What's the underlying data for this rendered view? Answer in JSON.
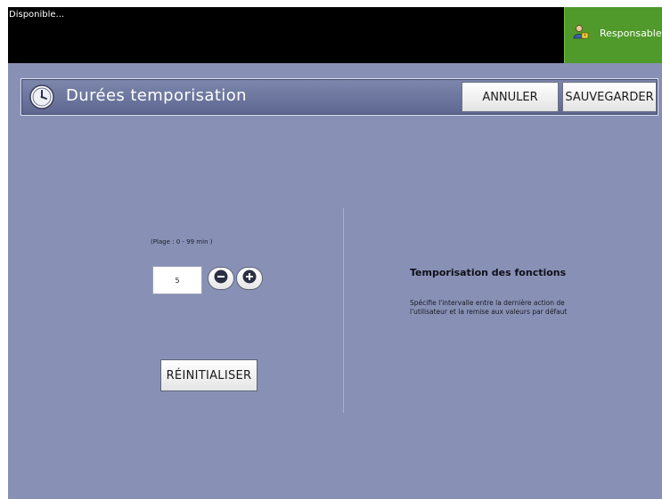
{
  "status_bar": {
    "status_text": "Disponible...",
    "user_label": "Responsable",
    "user_icon": "user-key-icon"
  },
  "header": {
    "title": "Durées temporisation",
    "title_icon": "clock-icon",
    "cancel_label": "ANNULER",
    "save_label": "SAUVEGARDER"
  },
  "control": {
    "range_label": "(Plage :  0 - 99 min )",
    "value": "5",
    "minus_icon": "minus-icon",
    "plus_icon": "plus-icon",
    "reset_label": "RÉINITIALISER"
  },
  "description": {
    "title": "Temporisation des fonctions",
    "text": "Spécifie l'intervalle entre la dernière action de l'utilisateur et la remise aux valeurs par défaut"
  },
  "colors": {
    "background": "#8891b5",
    "status_bar": "#000000",
    "user_button": "#4f9a2a",
    "title_bar": "#6a739a"
  }
}
